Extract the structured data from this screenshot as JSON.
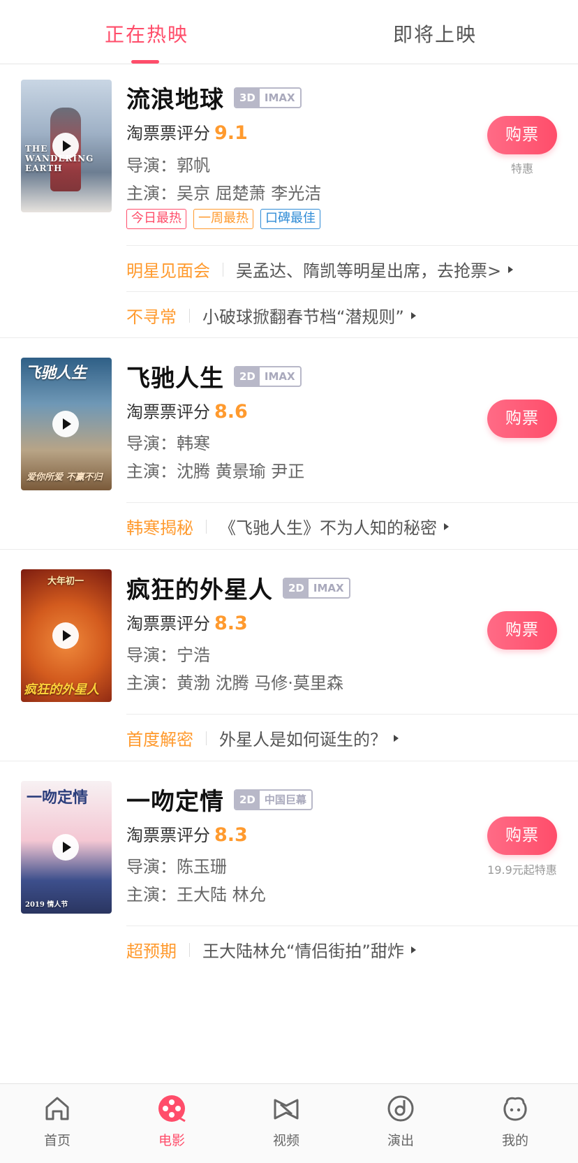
{
  "tabs": {
    "now_showing": "正在热映",
    "coming_soon": "即将上映"
  },
  "movies": [
    {
      "title": "流浪地球",
      "format": {
        "dim": "3D",
        "screen": "IMAX"
      },
      "score_label": "淘票票评分",
      "score": "9.1",
      "director_label": "导演：",
      "director": "郭帆",
      "cast_label": "主演：",
      "cast": "吴京 屈楚萧 李光洁",
      "buy_label": "购票",
      "buy_note": "特惠",
      "tags": [
        "今日最热",
        "一周最热",
        "口碑最佳"
      ],
      "poster_text": "THE WANDERING EARTH",
      "promos": [
        {
          "key": "明星见面会",
          "text": "吴孟达、隋凯等明星出席，去抢票>"
        },
        {
          "key": "不寻常",
          "text": "小破球掀翻春节档“潜规则”"
        }
      ]
    },
    {
      "title": "飞驰人生",
      "format": {
        "dim": "2D",
        "screen": "IMAX"
      },
      "score_label": "淘票票评分",
      "score": "8.6",
      "director_label": "导演：",
      "director": "韩寒",
      "cast_label": "主演：",
      "cast": "沈腾 黄景瑜 尹正",
      "buy_label": "购票",
      "poster_text": "飞驰人生",
      "poster_caption": "爱你所爱 不赢不归",
      "promos": [
        {
          "key": "韩寒揭秘",
          "text": "《飞驰人生》不为人知的秘密"
        }
      ]
    },
    {
      "title": "疯狂的外星人",
      "format": {
        "dim": "2D",
        "screen": "IMAX"
      },
      "score_label": "淘票票评分",
      "score": "8.3",
      "director_label": "导演：",
      "director": "宁浩",
      "cast_label": "主演：",
      "cast": "黄渤 沈腾 马修·莫里森",
      "buy_label": "购票",
      "poster_text": "大年初一",
      "poster_caption": "疯狂的外星人",
      "promos": [
        {
          "key": "首度解密",
          "text": "外星人是如何诞生的？"
        }
      ]
    },
    {
      "title": "一吻定情",
      "format": {
        "dim": "2D",
        "screen": "中国巨幕"
      },
      "score_label": "淘票票评分",
      "score": "8.3",
      "director_label": "导演：",
      "director": "陈玉珊",
      "cast_label": "主演：",
      "cast": "王大陆 林允",
      "buy_label": "购票",
      "buy_note": "19.9元起特惠",
      "poster_text": "一吻定情",
      "poster_caption": "2019 情人节",
      "promos": [
        {
          "key": "超预期",
          "text": "王大陆林允“情侣街拍”甜炸"
        }
      ]
    }
  ],
  "nav": [
    {
      "label": "首页",
      "icon": "home-icon"
    },
    {
      "label": "电影",
      "icon": "film-reel-icon"
    },
    {
      "label": "视频",
      "icon": "video-icon"
    },
    {
      "label": "演出",
      "icon": "show-disc-icon"
    },
    {
      "label": "我的",
      "icon": "profile-icon"
    }
  ],
  "colors": {
    "accent": "#ff4d6a",
    "score": "#ff9a2e",
    "promo_key": "#ff9a2e"
  }
}
